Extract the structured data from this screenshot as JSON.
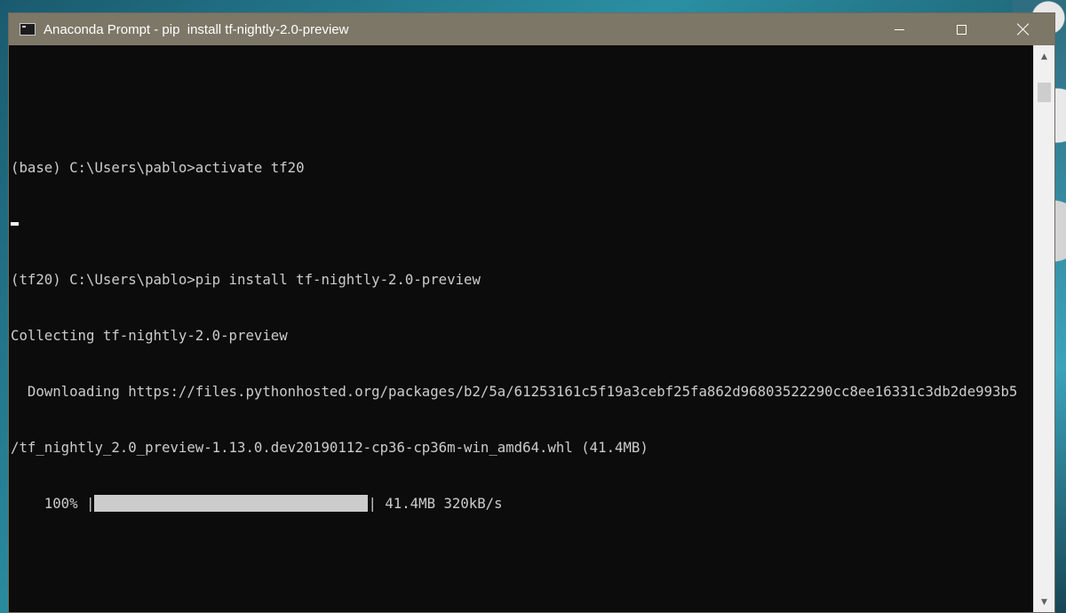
{
  "window": {
    "title": "Anaconda Prompt - pip  install tf-nightly-2.0-preview",
    "controls": {
      "minimize": "minimize-icon",
      "maximize": "maximize-icon",
      "close": "close-icon"
    }
  },
  "console": {
    "lines": [
      "",
      "(base) C:\\Users\\pablo>activate tf20",
      "",
      "(tf20) C:\\Users\\pablo>pip install tf-nightly-2.0-preview",
      "Collecting tf-nightly-2.0-preview",
      "  Downloading https://files.pythonhosted.org/packages/b2/5a/61253161c5f19a3cebf25fa862d96803522290cc8ee16331c3db2de993b5",
      "/tf_nightly_2.0_preview-1.13.0.dev20190112-cp36-cp36m-win_amd64.whl (41.4MB)"
    ],
    "progress": {
      "prefix": "    100% |",
      "percent": 100,
      "suffix": "| 41.4MB 320kB/s"
    }
  },
  "scrollbar": {
    "up_icon": "triangle-up-icon",
    "down_icon": "triangle-down-icon"
  }
}
